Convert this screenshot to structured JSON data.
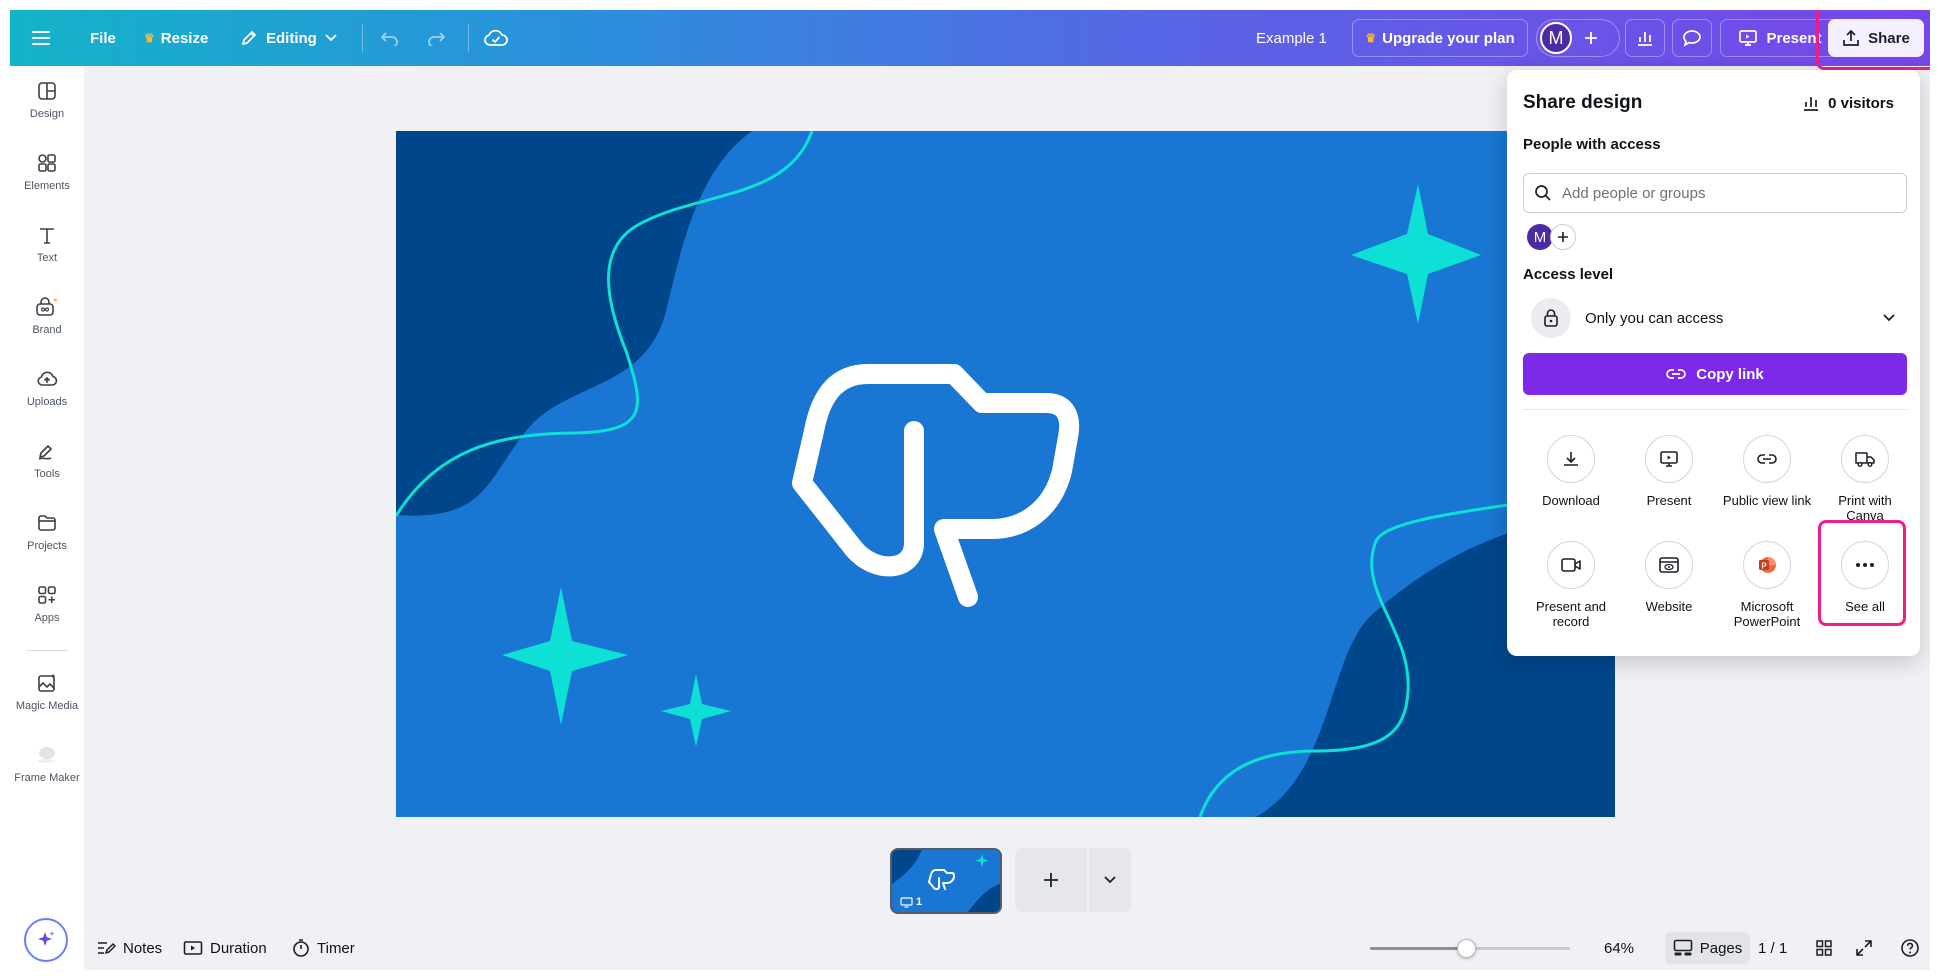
{
  "topbar": {
    "file": "File",
    "resize": "Resize",
    "mode": "Editing",
    "doc_title": "Example 1",
    "upgrade": "Upgrade your plan",
    "avatar_initial": "M",
    "present": "Present",
    "share": "Share"
  },
  "sidebar": {
    "items": [
      {
        "label": "Design",
        "icon": "design-icon"
      },
      {
        "label": "Elements",
        "icon": "elements-icon"
      },
      {
        "label": "Text",
        "icon": "text-icon"
      },
      {
        "label": "Brand",
        "icon": "brand-icon"
      },
      {
        "label": "Uploads",
        "icon": "uploads-icon"
      },
      {
        "label": "Tools",
        "icon": "tools-icon"
      },
      {
        "label": "Projects",
        "icon": "projects-icon"
      },
      {
        "label": "Apps",
        "icon": "apps-icon"
      },
      {
        "label": "Magic Media",
        "icon": "magic-media-icon"
      },
      {
        "label": "Frame Maker",
        "icon": "frame-maker-icon"
      }
    ]
  },
  "page_strip": {
    "thumb_page_number": "1"
  },
  "bottombar": {
    "notes": "Notes",
    "duration": "Duration",
    "timer": "Timer",
    "zoom": "64%",
    "zoom_level": 0.64,
    "pages": "Pages",
    "page_count": "1 / 1"
  },
  "share_panel": {
    "title": "Share design",
    "visitors": "0 visitors",
    "people_label": "People with access",
    "search_placeholder": "Add people or groups",
    "member_initial": "M",
    "access_label": "Access level",
    "access_value": "Only you can access",
    "copy_link": "Copy link",
    "options": [
      {
        "label": "Download",
        "icon": "download-icon"
      },
      {
        "label": "Present",
        "icon": "present-icon"
      },
      {
        "label": "Public view link",
        "icon": "link-icon"
      },
      {
        "label": "Print with Canva",
        "icon": "truck-icon"
      },
      {
        "label": "Present and record",
        "icon": "record-icon"
      },
      {
        "label": "Website",
        "icon": "website-icon"
      },
      {
        "label": "Microsoft PowerPoint",
        "icon": "powerpoint-icon"
      },
      {
        "label": "See all",
        "icon": "more-icon"
      }
    ]
  },
  "colors": {
    "accent": "#7d2ae8",
    "highlight": "#ee1f87",
    "canvas_blue": "#1976d2",
    "canvas_dark": "#00468a",
    "sparkle": "#0ee0d6"
  }
}
